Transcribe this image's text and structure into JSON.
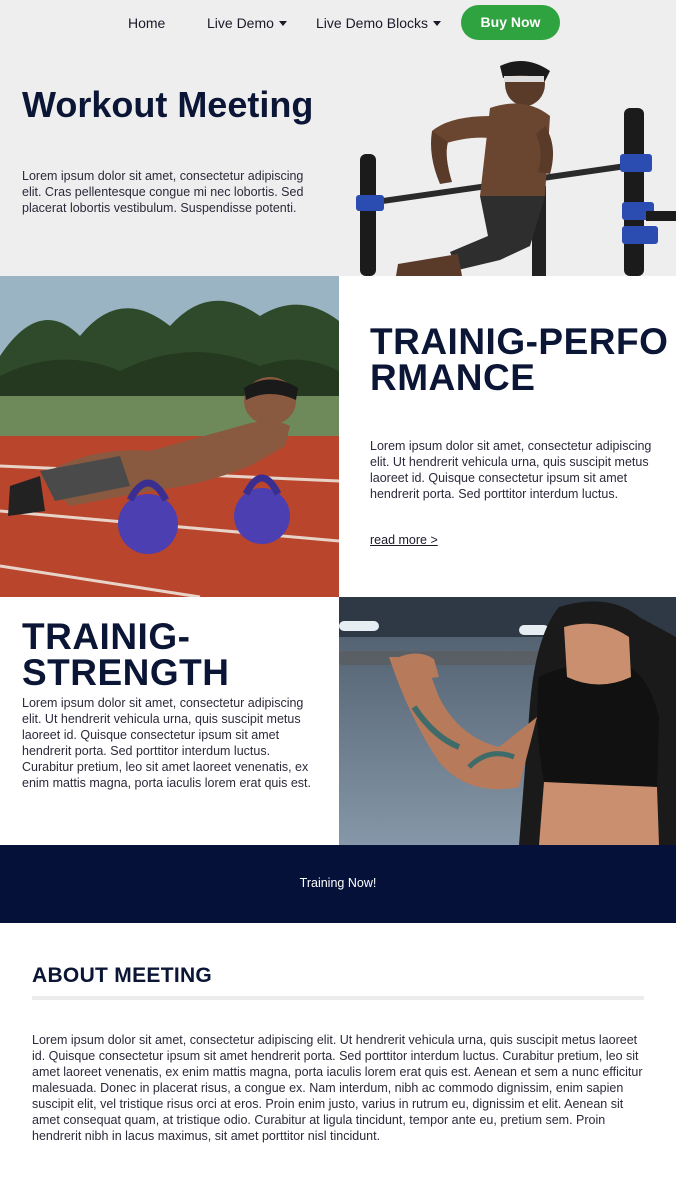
{
  "nav": {
    "items": [
      {
        "label": "Home",
        "dropdown": false
      },
      {
        "label": "Live Demo",
        "dropdown": true
      },
      {
        "label": "Live Demo Blocks",
        "dropdown": true
      }
    ],
    "cta_label": "Buy Now",
    "cta_color": "#2fa33f"
  },
  "hero": {
    "title": "Workout Meeting",
    "text": "Lorem ipsum dolor sit amet, consectetur adipiscing elit. Cras pellentesque congue mi nec lobortis. Sed placerat lobortis vestibulum. Suspendisse potenti."
  },
  "performance": {
    "title": "TRAINIG-PERFORMANCE",
    "text": "Lorem ipsum dolor sit amet, consectetur adipiscing elit. Ut hendrerit vehicula urna, quis suscipit metus laoreet id. Quisque consectetur ipsum sit amet hendrerit porta. Sed porttitor interdum luctus.",
    "link": "read more >"
  },
  "strength": {
    "title": "TRAINIG-STRENGTH",
    "text": "Lorem ipsum dolor sit amet, consectetur adipiscing elit. Ut hendrerit vehicula urna, quis suscipit metus laoreet id. Quisque consectetur ipsum sit amet hendrerit porta. Sed porttitor interdum luctus. Curabitur pretium, leo sit amet laoreet venenatis, ex enim mattis magna, porta iaculis lorem erat quis est."
  },
  "cta": {
    "label": "Training Now!",
    "background": "#06113a"
  },
  "about": {
    "title": "ABOUT MEETING",
    "text": "Lorem ipsum dolor sit amet, consectetur adipiscing elit. Ut hendrerit vehicula urna, quis suscipit metus laoreet id. Quisque consectetur ipsum sit amet hendrerit porta. Sed porttitor interdum luctus. Curabitur pretium, leo sit amet laoreet venenatis, ex enim mattis magna, porta iaculis lorem erat quis est. Aenean et sem a nunc efficitur malesuada. Donec in placerat risus, a congue ex. Nam interdum, nibh ac commodo dignissim, enim sapien suscipit elit, vel tristique risus orci at eros. Proin enim justo, varius in rutrum eu, dignissim et elit. Aenean sit amet consequat quam, at tristique odio. Curabitur at ligula tincidunt, tempor ante eu, pretium sem. Proin hendrerit nibh in lacus maximus, sit amet porttitor nisl tincidunt."
  },
  "colors": {
    "heading": "#0b1535",
    "nav_background": "#eeeeee"
  }
}
